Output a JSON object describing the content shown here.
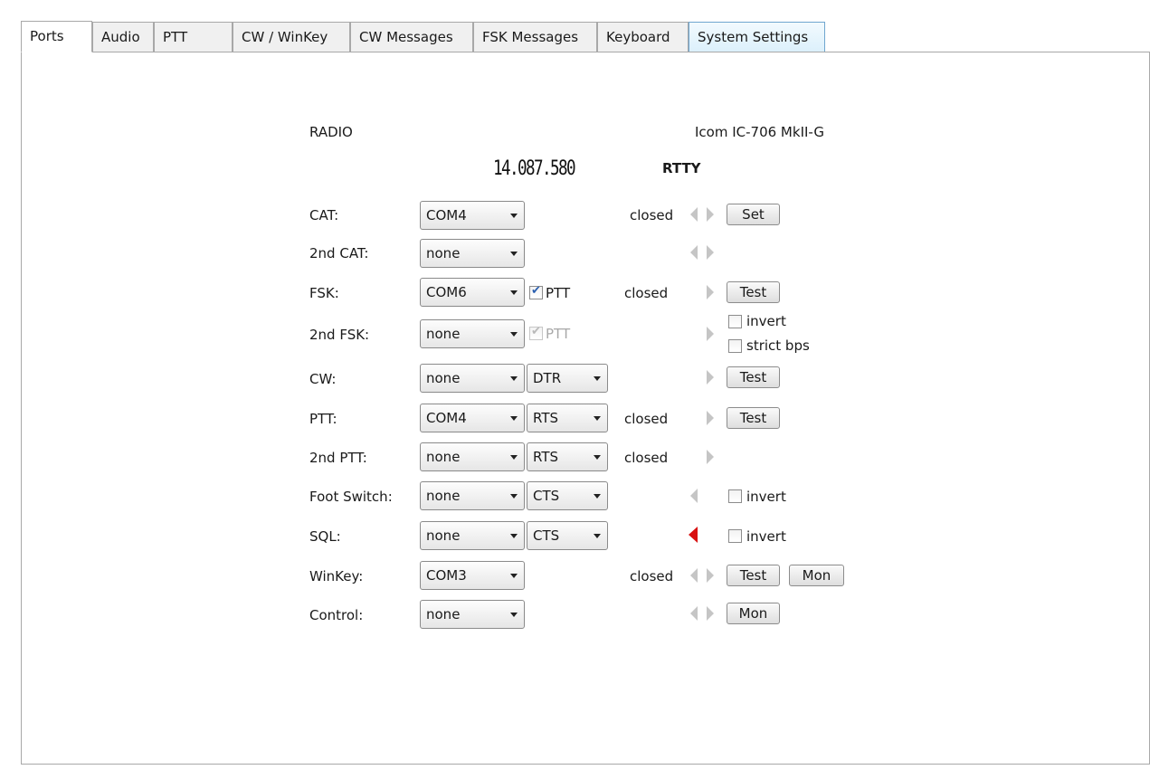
{
  "tabs": [
    "Ports",
    "Audio",
    "PTT",
    "CW / WinKey",
    "CW Messages",
    "FSK Messages",
    "Keyboard",
    "System Settings"
  ],
  "radio": {
    "label": "RADIO",
    "model": "Icom IC-706 MkII-G",
    "frequency": "14.087.580",
    "mode": "RTTY"
  },
  "rows": {
    "cat": {
      "label": "CAT:",
      "port": "COM4",
      "status": "closed",
      "button": "Set"
    },
    "cat2": {
      "label": "2nd CAT:",
      "port": "none"
    },
    "fsk": {
      "label": "FSK:",
      "port": "COM6",
      "ptt_label": "PTT",
      "ptt_checked": true,
      "status": "closed",
      "button": "Test"
    },
    "fsk2": {
      "label": "2nd FSK:",
      "port": "none",
      "ptt_label": "PTT",
      "ptt_checked": true,
      "invert_label": "invert",
      "strict_label": "strict bps"
    },
    "cw": {
      "label": "CW:",
      "port": "none",
      "line": "DTR",
      "button": "Test"
    },
    "ptt": {
      "label": "PTT:",
      "port": "COM4",
      "line": "RTS",
      "status": "closed",
      "button": "Test"
    },
    "ptt2": {
      "label": "2nd PTT:",
      "port": "none",
      "line": "RTS",
      "status": "closed"
    },
    "foot": {
      "label": "Foot Switch:",
      "port": "none",
      "line": "CTS",
      "invert_label": "invert"
    },
    "sql": {
      "label": "SQL:",
      "port": "none",
      "line": "CTS",
      "invert_label": "invert",
      "indicator_color": "#d81010"
    },
    "winkey": {
      "label": "WinKey:",
      "port": "COM3",
      "status": "closed",
      "button_test": "Test",
      "button_mon": "Mon"
    },
    "control": {
      "label": "Control:",
      "port": "none",
      "button_mon": "Mon"
    }
  }
}
